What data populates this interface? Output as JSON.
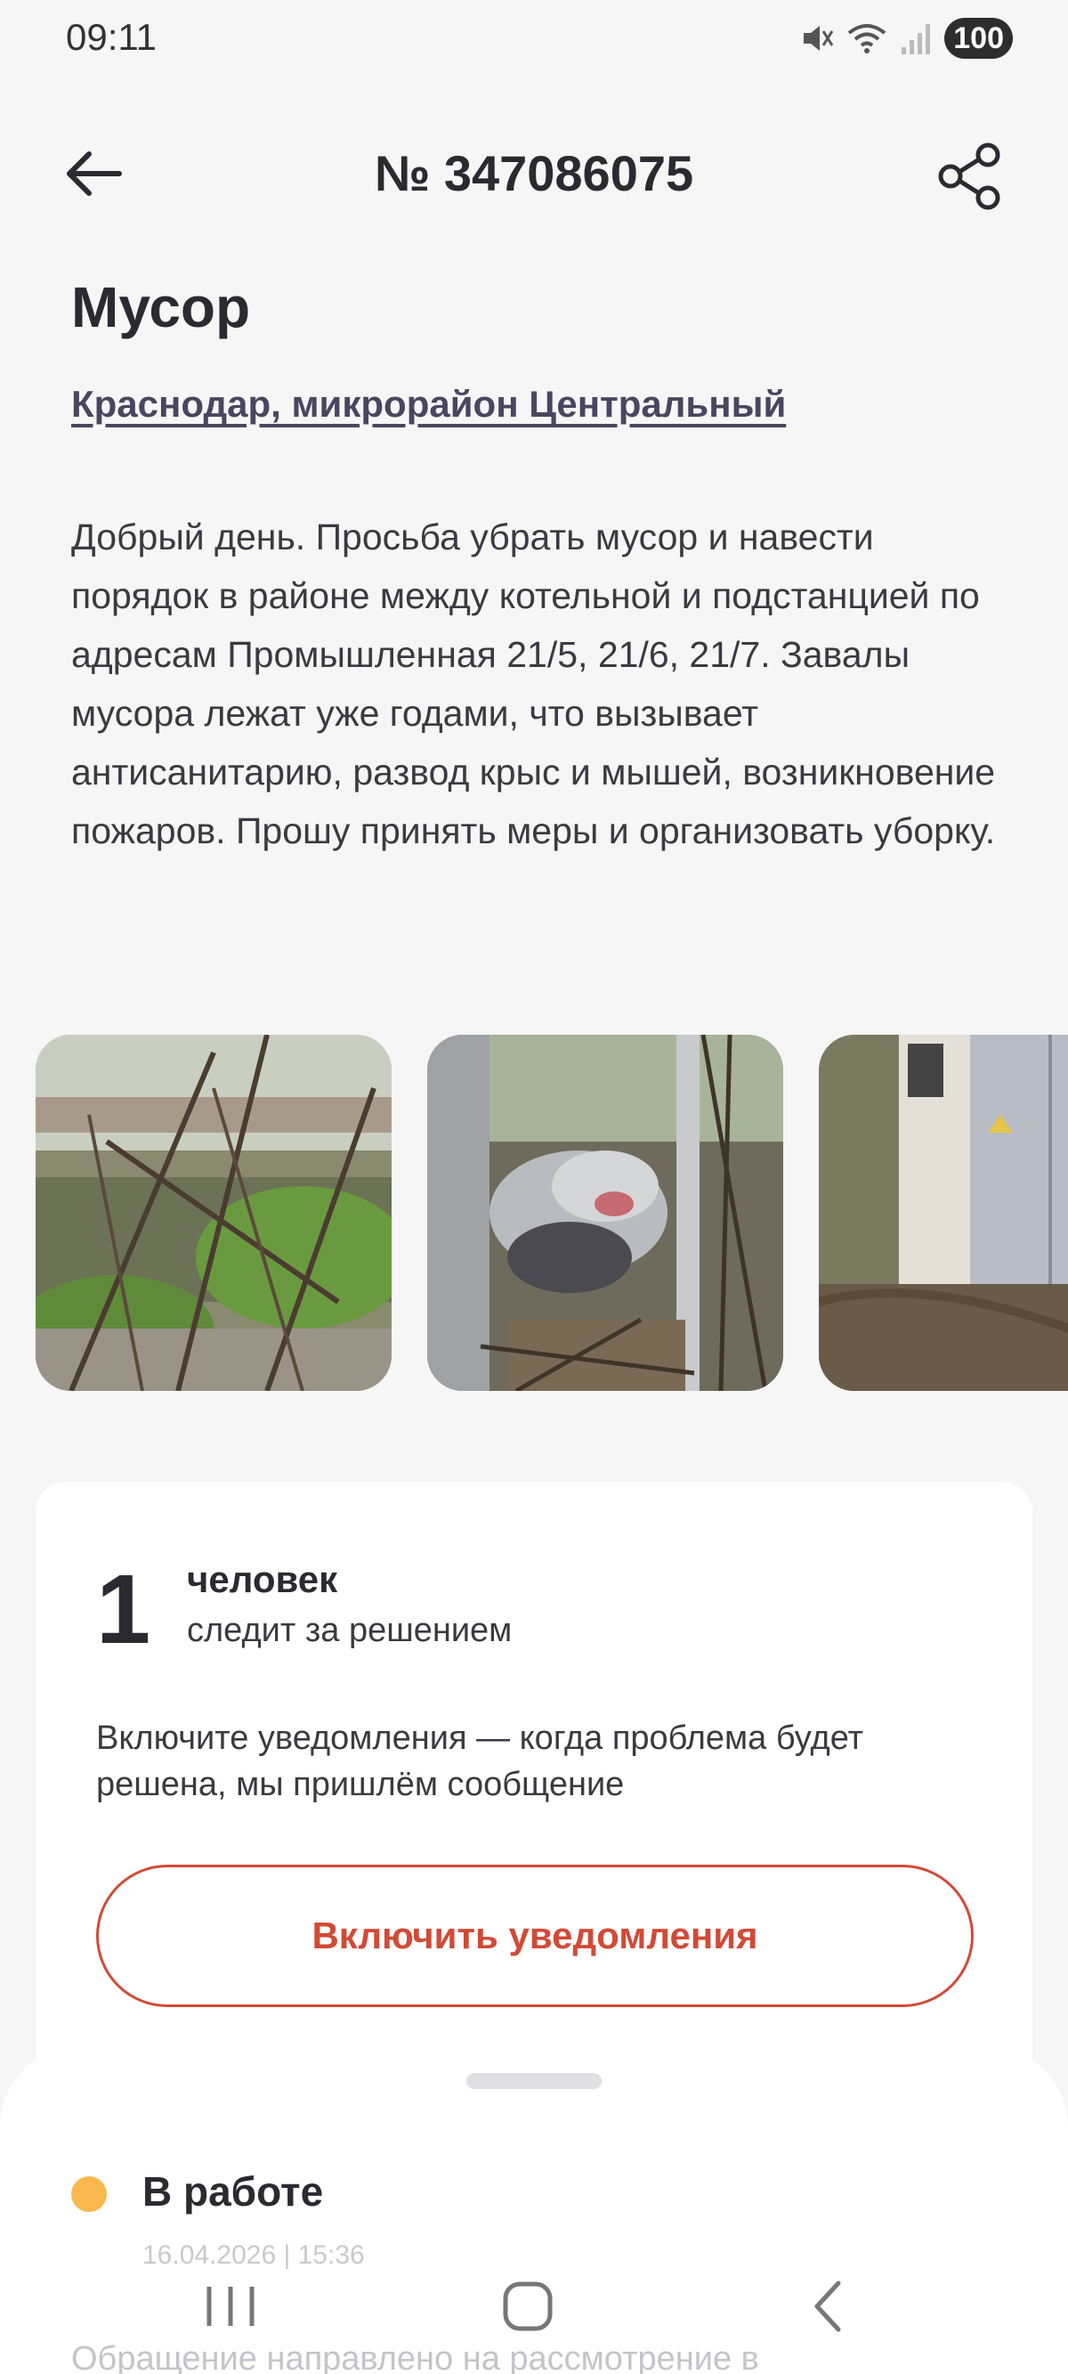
{
  "status_bar": {
    "time": "09:11",
    "battery": "100",
    "icons": [
      "mute-icon",
      "wifi-icon",
      "signal-icon"
    ]
  },
  "header": {
    "title": "№ 347086075",
    "back_icon": "arrow-left-icon",
    "share_icon": "share-icon"
  },
  "issue": {
    "category": "Мусор",
    "location": "Краснодар, микрорайон Центральный",
    "description": "Добрый день. Просьба убрать мусор и навести порядок в районе между котельной и подстанцией по адресам Промышленная 21/5, 21/6, 21/7. Завалы мусора лежат уже годами, что вызывает антисанитарию, развод крыс и мышей, возникновение пожаров. Прошу принять меры и организовать уборку."
  },
  "photos": [
    {
      "name": "photo-thumbnail-1"
    },
    {
      "name": "photo-thumbnail-2"
    },
    {
      "name": "photo-thumbnail-3"
    }
  ],
  "followers": {
    "count": "1",
    "unit": "человек",
    "note": "следит за решением",
    "notify_text": "Включите уведомления — когда проблема будет решена, мы пришлём сообщение",
    "notify_button": "Включить уведомления"
  },
  "status_sheet": {
    "status": "В работе",
    "date": "16.04.2026 | 15:36",
    "description": "Обращение направлено на рассмотрение в",
    "status_color": "#f8b84c"
  },
  "colors": {
    "accent": "#d24a36",
    "background": "#f6f6f6"
  },
  "navbar": {
    "icons": [
      "recent-apps-icon",
      "home-icon",
      "nav-back-icon"
    ]
  }
}
